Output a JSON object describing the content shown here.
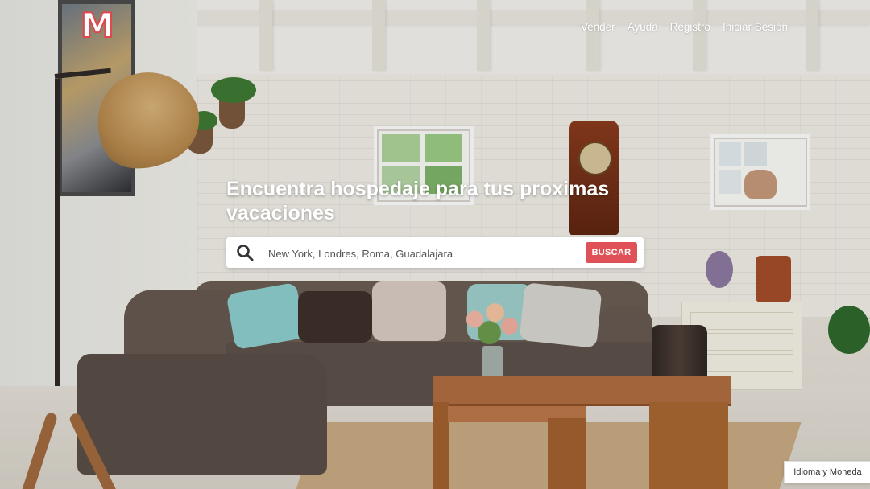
{
  "brand": {
    "logo_text": "M",
    "accent_color": "#e0474c"
  },
  "nav": {
    "items": [
      {
        "label": "Vender"
      },
      {
        "label": "Ayuda"
      },
      {
        "label": "Registro"
      },
      {
        "label": "Iniciar Sesión"
      }
    ]
  },
  "hero": {
    "headline": "Encuentra hospedaje para tus proximas vacaciones",
    "background_image": "living-room-photo"
  },
  "search": {
    "icon": "search-icon",
    "placeholder": "New York, Londres, Roma, Guadalajara",
    "value": "",
    "button_label": "BUSCAR",
    "button_color": "#e05157"
  },
  "footer": {
    "locale_button_label": "Idioma y Moneda"
  }
}
